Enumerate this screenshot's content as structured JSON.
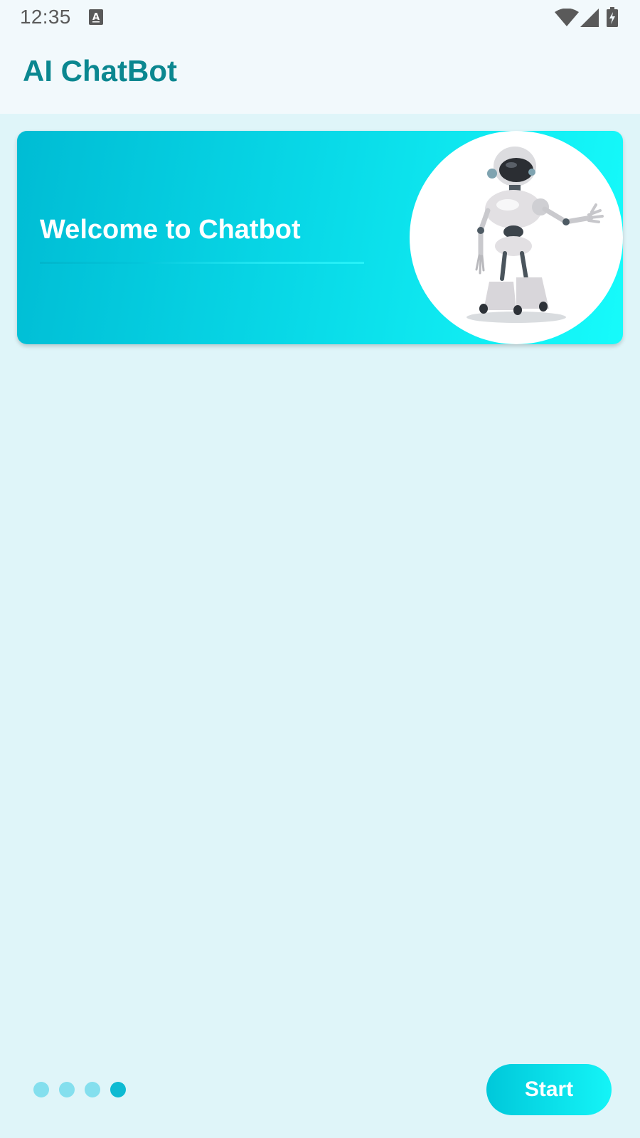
{
  "status_bar": {
    "time": "12:35",
    "icons": [
      "keyboard-a-icon",
      "wifi-icon",
      "cell-signal-icon",
      "battery-charging-icon"
    ]
  },
  "app_bar": {
    "title": "AI ChatBot"
  },
  "welcome_card": {
    "title": "Welcome to Chatbot",
    "image": "robot-illustration"
  },
  "onboarding": {
    "page_count": 4,
    "current_page": 4,
    "start_label": "Start"
  },
  "colors": {
    "accent": "#0b8790",
    "background": "#dff5f9",
    "card_gradient_start": "#00bcd4",
    "card_gradient_end": "#16fbfb",
    "dot_inactive": "#84dfee",
    "dot_active": "#0ebad2"
  }
}
